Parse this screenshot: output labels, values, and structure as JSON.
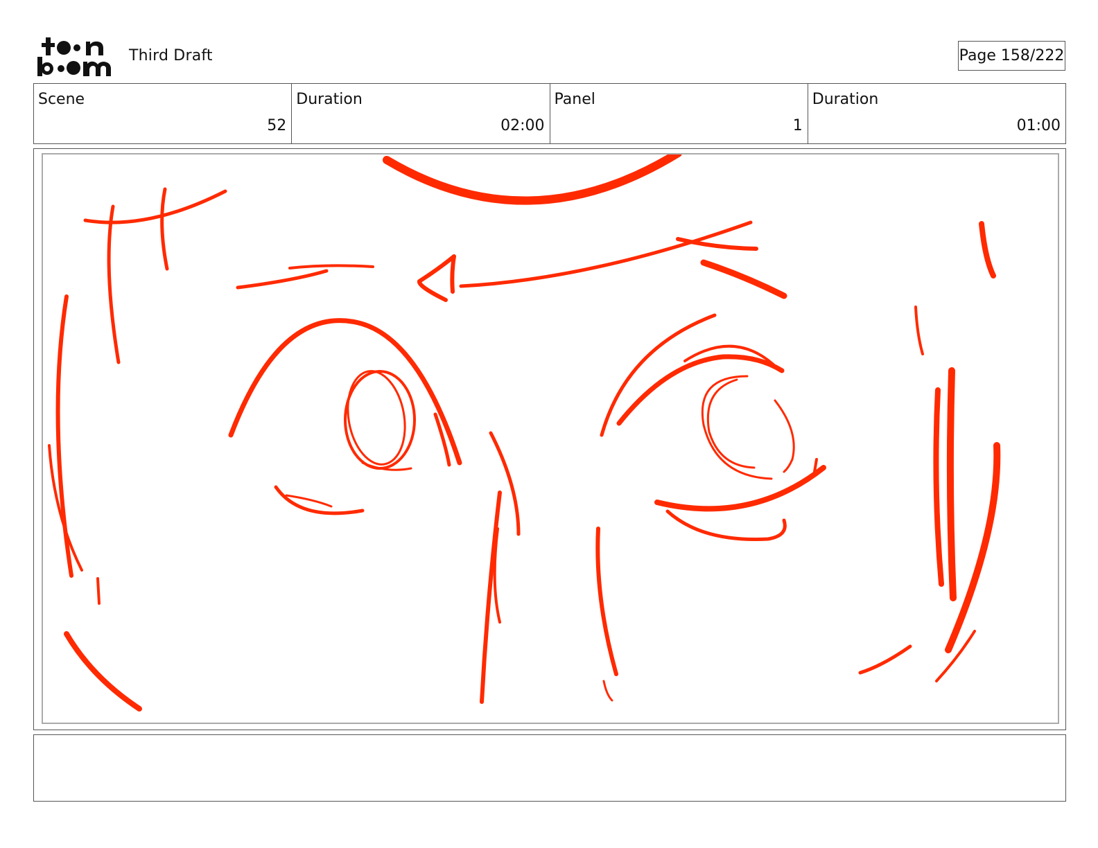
{
  "header": {
    "logo_top": "toon",
    "logo_bottom": "boom",
    "draft_title": "Third Draft",
    "page_label": "Page 158/222"
  },
  "info": {
    "scene_label": "Scene",
    "scene_value": "52",
    "scene_duration_label": "Duration",
    "scene_duration_value": "02:00",
    "panel_label": "Panel",
    "panel_value": "1",
    "panel_duration_label": "Duration",
    "panel_duration_value": "01:00"
  },
  "panel": {
    "sketch_color": "#ff2a00",
    "description": ""
  },
  "notes": {
    "text": ""
  }
}
